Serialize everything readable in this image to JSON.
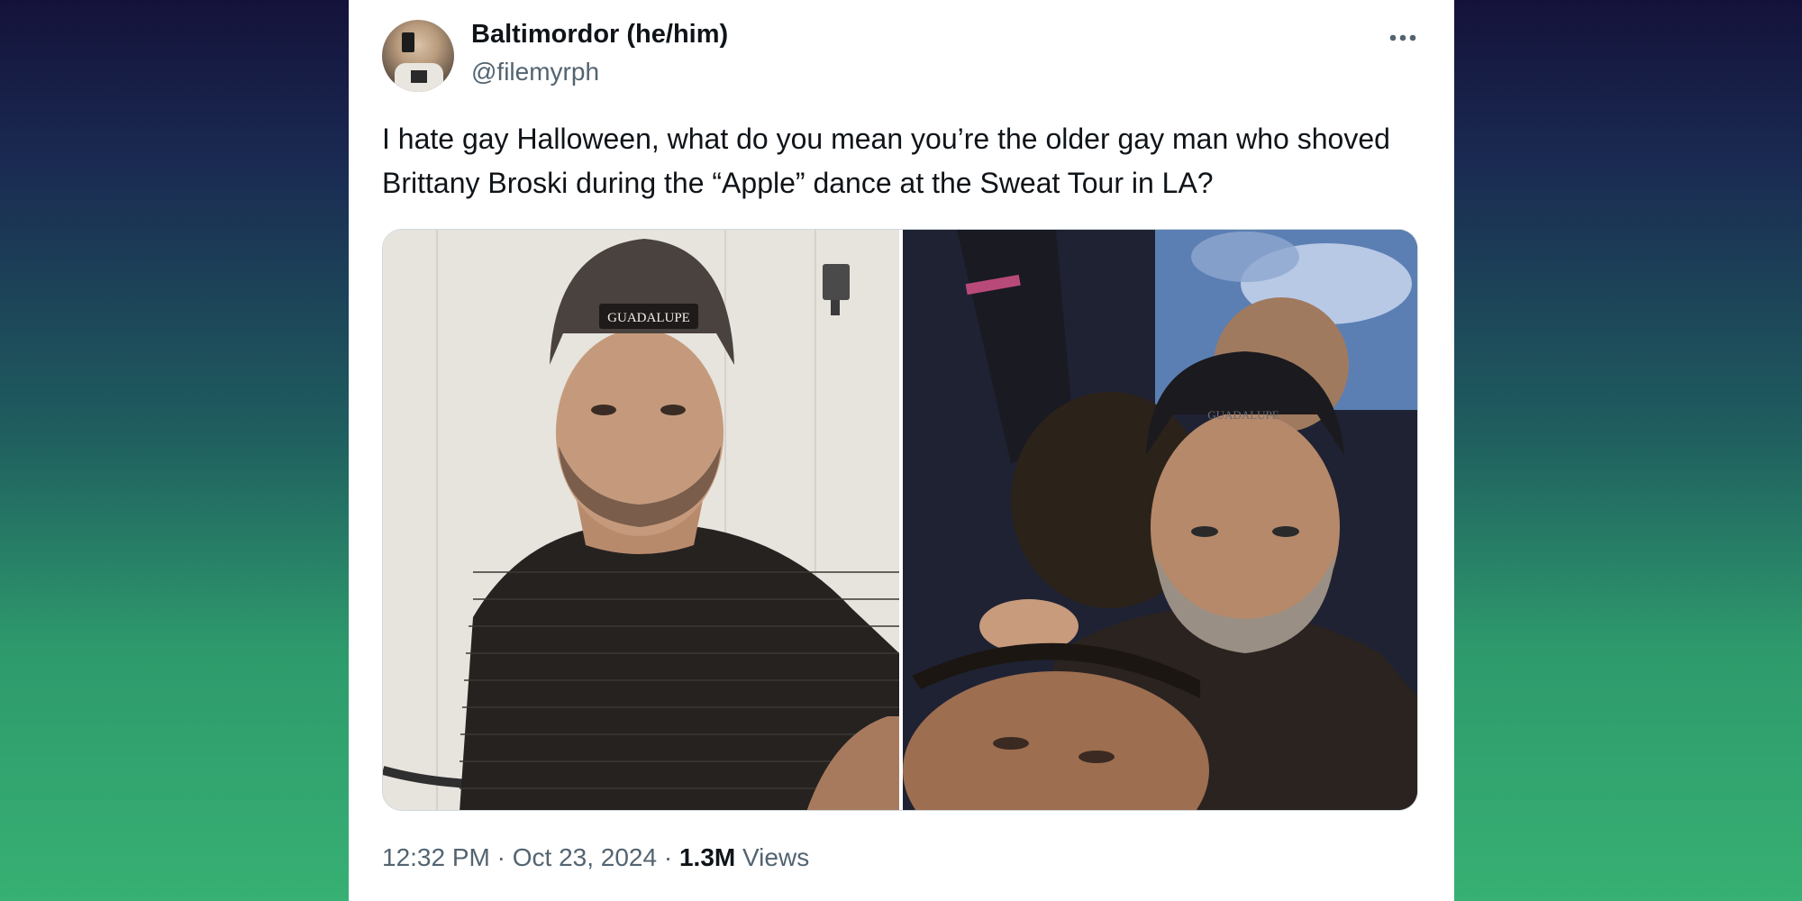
{
  "post": {
    "author_name": "Baltimordor (he/him)",
    "author_handle": "@filemyrph",
    "text": "I hate gay Halloween, what do you mean you’re the older gay man who shoved Brittany Broski during the “Apple” dance at the Sweat Tour in LA?",
    "media": [
      {
        "cap_text": "GUADALUPE"
      },
      {
        "cap_text": "GUADALUPE"
      }
    ],
    "time": "12:32 PM",
    "separator": "·",
    "date": "Oct 23, 2024",
    "views_count": "1.3M",
    "views_label": "Views"
  },
  "icons": {
    "more": "more-horizontal-icon"
  },
  "colors": {
    "text_primary": "#0f1419",
    "text_secondary": "#536471",
    "card_background": "#ffffff"
  }
}
